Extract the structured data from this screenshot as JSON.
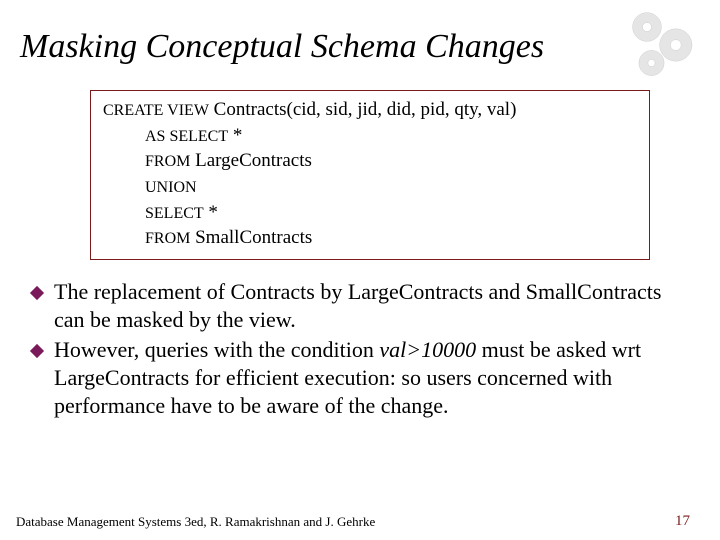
{
  "title": "Masking Conceptual Schema Changes",
  "code": {
    "l1a": "CREATE VIEW",
    "l1b": "  Contracts(cid, sid, jid, did, pid, qty, val)",
    "l2a": "AS  SELECT",
    "l2b": "  *",
    "l3a": "FROM",
    "l3b": "  LargeContracts",
    "l4a": "UNION",
    "l5a": "SELECT",
    "l5b": "  *",
    "l6a": "FROM",
    "l6b": "  SmallContracts"
  },
  "bullets": {
    "b1": "The replacement of Contracts by LargeContracts and SmallContracts can be masked by the view.",
    "b2a": "However, queries with the condition ",
    "b2i": "val>10000",
    "b2b": " must be asked wrt LargeContracts for efficient execution:  so users concerned with performance have to be aware of the change."
  },
  "footer": {
    "left": "Database Management Systems 3ed,  R. Ramakrishnan and J. Gehrke",
    "right": "17"
  }
}
